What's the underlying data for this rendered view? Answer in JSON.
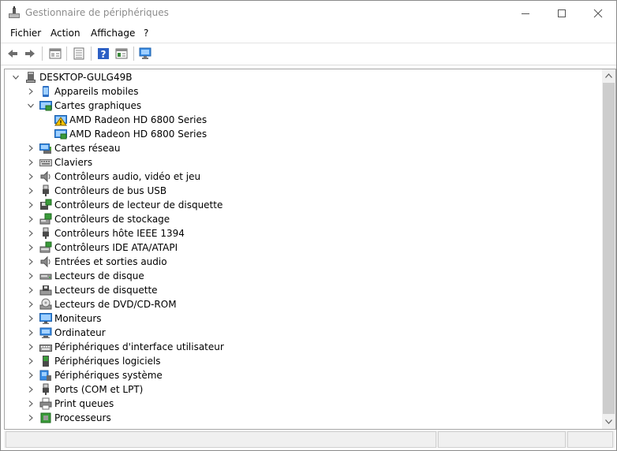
{
  "window": {
    "title": "Gestionnaire de périphériques",
    "minimize_icon": "minimize-icon",
    "maximize_icon": "maximize-icon",
    "close_icon": "close-icon"
  },
  "menu": [
    "Fichier",
    "Action",
    "Affichage",
    "?"
  ],
  "toolbar": [
    "back-arrow-icon",
    "forward-arrow-icon",
    "properties-sheet-icon",
    "details-list-icon",
    "help-icon",
    "panel-view-icon",
    "monitor-scan-icon"
  ],
  "tree": {
    "root": "DESKTOP-GULG49B",
    "items": [
      {
        "label": "Appareils mobiles",
        "icon": "mobile-device-icon",
        "state": "collapsed"
      },
      {
        "label": "Cartes graphiques",
        "icon": "display-adapter-icon",
        "state": "expanded"
      },
      {
        "label": "AMD Radeon HD 6800 Series",
        "icon": "display-adapter-warning-icon",
        "state": "child"
      },
      {
        "label": "AMD Radeon HD 6800 Series",
        "icon": "display-adapter-icon",
        "state": "child"
      },
      {
        "label": "Cartes réseau",
        "icon": "network-adapter-icon",
        "state": "collapsed"
      },
      {
        "label": "Claviers",
        "icon": "keyboard-icon",
        "state": "collapsed"
      },
      {
        "label": "Contrôleurs audio, vidéo et jeu",
        "icon": "speaker-icon",
        "state": "collapsed"
      },
      {
        "label": "Contrôleurs de bus USB",
        "icon": "usb-plug-icon",
        "state": "collapsed"
      },
      {
        "label": "Contrôleurs de lecteur de disquette",
        "icon": "floppy-controller-icon",
        "state": "collapsed"
      },
      {
        "label": "Contrôleurs de stockage",
        "icon": "storage-controller-icon",
        "state": "collapsed"
      },
      {
        "label": "Contrôleurs hôte IEEE 1394",
        "icon": "ieee1394-plug-icon",
        "state": "collapsed"
      },
      {
        "label": "Contrôleurs IDE ATA/ATAPI",
        "icon": "ide-controller-icon",
        "state": "collapsed"
      },
      {
        "label": "Entrées et sorties audio",
        "icon": "speaker-icon",
        "state": "collapsed"
      },
      {
        "label": "Lecteurs de disque",
        "icon": "disk-drive-icon",
        "state": "collapsed"
      },
      {
        "label": "Lecteurs de disquette",
        "icon": "floppy-drive-icon",
        "state": "collapsed"
      },
      {
        "label": "Lecteurs de DVD/CD-ROM",
        "icon": "dvd-drive-icon",
        "state": "collapsed"
      },
      {
        "label": "Moniteurs",
        "icon": "monitor-icon",
        "state": "collapsed"
      },
      {
        "label": "Ordinateur",
        "icon": "computer-icon",
        "state": "collapsed"
      },
      {
        "label": "Périphériques d'interface utilisateur",
        "icon": "hid-keyboard-icon",
        "state": "collapsed"
      },
      {
        "label": "Périphériques logiciels",
        "icon": "software-device-icon",
        "state": "collapsed"
      },
      {
        "label": "Périphériques système",
        "icon": "system-device-icon",
        "state": "collapsed"
      },
      {
        "label": "Ports (COM et LPT)",
        "icon": "port-plug-icon",
        "state": "collapsed"
      },
      {
        "label": "Print queues",
        "icon": "printer-icon",
        "state": "collapsed"
      },
      {
        "label": "Processeurs",
        "icon": "processor-chip-icon",
        "state": "collapsed"
      }
    ]
  },
  "colors": {
    "title_text": "#8c8c8c",
    "scrollbar_track": "#f0f0f0",
    "scrollbar_thumb": "#cdcdcd",
    "icon_blue": "#3a8ee6",
    "warning_yellow": "#f5c400"
  }
}
